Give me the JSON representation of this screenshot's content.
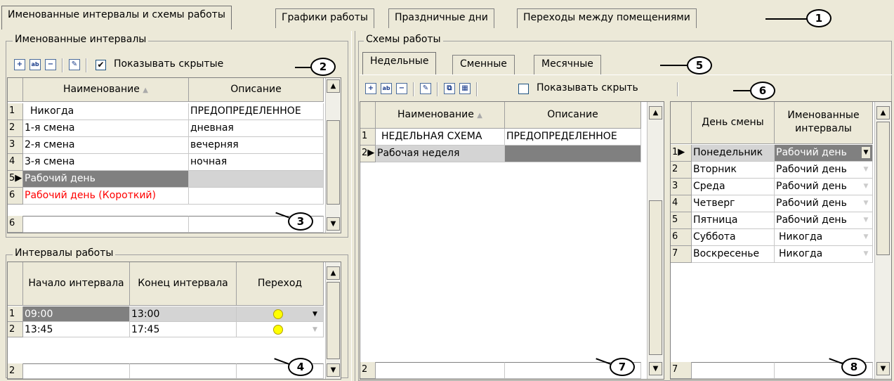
{
  "tabs": [
    {
      "label": "Именованные интервалы и схемы работы"
    },
    {
      "label": "Графики работы"
    },
    {
      "label": "Праздничные дни"
    },
    {
      "label": "Переходы между помещениями"
    }
  ],
  "named_intervals": {
    "title": "Именованные интервалы",
    "show_hidden": "Показывать скрытые",
    "columns": [
      "Наименование",
      "Описание"
    ],
    "rows": [
      {
        "n": "1",
        "name": "Никогда",
        "desc": "ПРЕДОПРЕДЕЛЕННОЕ"
      },
      {
        "n": "2",
        "name": "1-я смена",
        "desc": "дневная"
      },
      {
        "n": "3",
        "name": "2-я смена",
        "desc": "вечерняя"
      },
      {
        "n": "4",
        "name": "3-я смена",
        "desc": "ночная"
      },
      {
        "n": "5",
        "name": "Рабочий день",
        "desc": ""
      },
      {
        "n": "6",
        "name": "Рабочий день (Короткий)",
        "desc": ""
      }
    ],
    "footer_count": "6"
  },
  "work_intervals": {
    "title": "Интервалы работы",
    "columns": [
      "Начало интервала",
      "Конец интервала",
      "Переход"
    ],
    "rows": [
      {
        "n": "1",
        "start": "09:00",
        "end": "13:00"
      },
      {
        "n": "2",
        "start": "13:45",
        "end": "17:45"
      }
    ],
    "footer_count": "2"
  },
  "schemes": {
    "title": "Схемы работы",
    "subtabs": [
      "Недельные",
      "Сменные",
      "Месячные"
    ],
    "show_hidden": "Показывать скрыть",
    "columns": [
      "Наименование",
      "Описание"
    ],
    "rows": [
      {
        "n": "1",
        "name": "НЕДЕЛЬНАЯ СХЕМА",
        "desc": "ПРЕДОПРЕДЕЛЕННОЕ"
      },
      {
        "n": "2",
        "name": "Рабочая неделя",
        "desc": ""
      }
    ],
    "footer_count": "2"
  },
  "days": {
    "columns": [
      "День смены",
      "Именованные интервалы"
    ],
    "rows": [
      {
        "n": "1",
        "day": "Понедельник",
        "interval": "Рабочий день"
      },
      {
        "n": "2",
        "day": "Вторник",
        "interval": "Рабочий день"
      },
      {
        "n": "3",
        "day": "Среда",
        "interval": "Рабочий день"
      },
      {
        "n": "4",
        "day": "Четверг",
        "interval": "Рабочий день"
      },
      {
        "n": "5",
        "day": "Пятница",
        "interval": "Рабочий день"
      },
      {
        "n": "6",
        "day": "Суббота",
        "interval": "Никогда"
      },
      {
        "n": "7",
        "day": "Воскресенье",
        "interval": "Никогда"
      }
    ],
    "footer_count": "7"
  },
  "callouts": [
    "1",
    "2",
    "3",
    "4",
    "5",
    "6",
    "7",
    "8"
  ],
  "colors": {
    "accent_red": "#ff0000",
    "clock_yellow": "#ffff00",
    "selected_gray": "#808080"
  }
}
